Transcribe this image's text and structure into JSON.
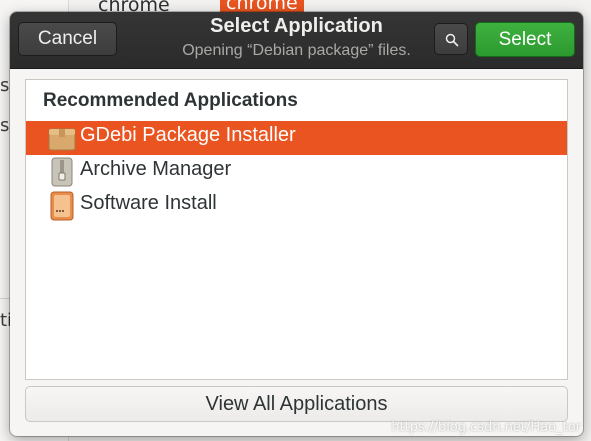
{
  "background": {
    "fragments": [
      "chrome",
      "chrome",
      "s",
      "s",
      "ti"
    ]
  },
  "dialog": {
    "cancel_label": "Cancel",
    "title": "Select Application",
    "subtitle": "Opening “Debian package” files.",
    "search_icon": "search-icon",
    "select_label": "Select",
    "section_title": "Recommended Applications",
    "apps": [
      {
        "label": "GDebi Package Installer",
        "icon": "package-icon",
        "selected": true
      },
      {
        "label": "Archive Manager",
        "icon": "archive-icon",
        "selected": false
      },
      {
        "label": "Software Install",
        "icon": "software-install-icon",
        "selected": false
      }
    ],
    "view_all_label": "View All Applications"
  },
  "watermark": "https://blog.csdn.net/Hao_tor",
  "colors": {
    "selection": "#e95420",
    "select_button": "#2c9a2f",
    "headerbar": "#2b2b2b"
  }
}
